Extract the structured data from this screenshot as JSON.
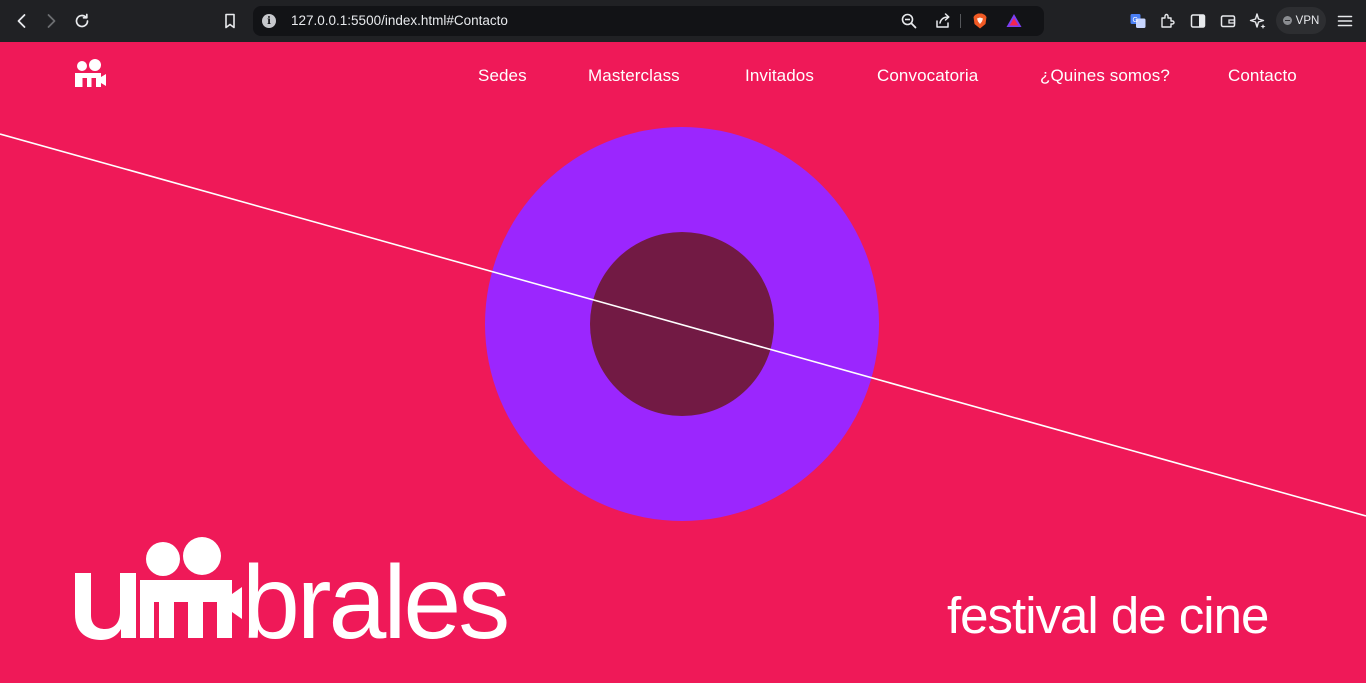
{
  "browser": {
    "url": "127.0.0.1:5500/index.html#Contacto",
    "vpn_label": "VPN",
    "colors": {
      "chrome": "#202124",
      "address_bg": "#121316",
      "text": "#e8eaed"
    }
  },
  "page": {
    "background": "#ef1958",
    "nav": {
      "items": [
        {
          "label": "Sedes"
        },
        {
          "label": "Masterclass"
        },
        {
          "label": "Invitados"
        },
        {
          "label": "Convocatoria"
        },
        {
          "label": "¿Quines somos?"
        },
        {
          "label": "Contacto"
        }
      ]
    },
    "hero": {
      "outer_circle_color": "#9b26fe",
      "inner_circle_color": "#721a44",
      "line_color": "#ffffff"
    },
    "brand": {
      "wordmark": "umbrales",
      "tagline": "festival de cine"
    }
  }
}
